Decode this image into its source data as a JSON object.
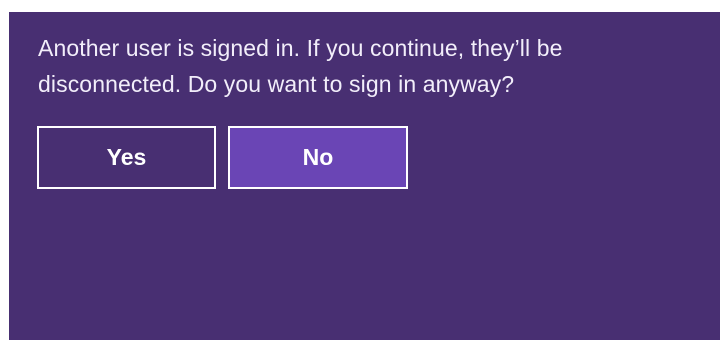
{
  "dialog": {
    "message": "Another user is signed in. If you continue, they’ll be disconnected. Do you want to sign in anyway?",
    "buttons": {
      "yes_label": "Yes",
      "no_label": "No"
    }
  },
  "colors": {
    "dialog_background": "#482f72",
    "primary_button": "#6a45b5",
    "text": "#ffffff",
    "page_background": "#ffffff"
  }
}
